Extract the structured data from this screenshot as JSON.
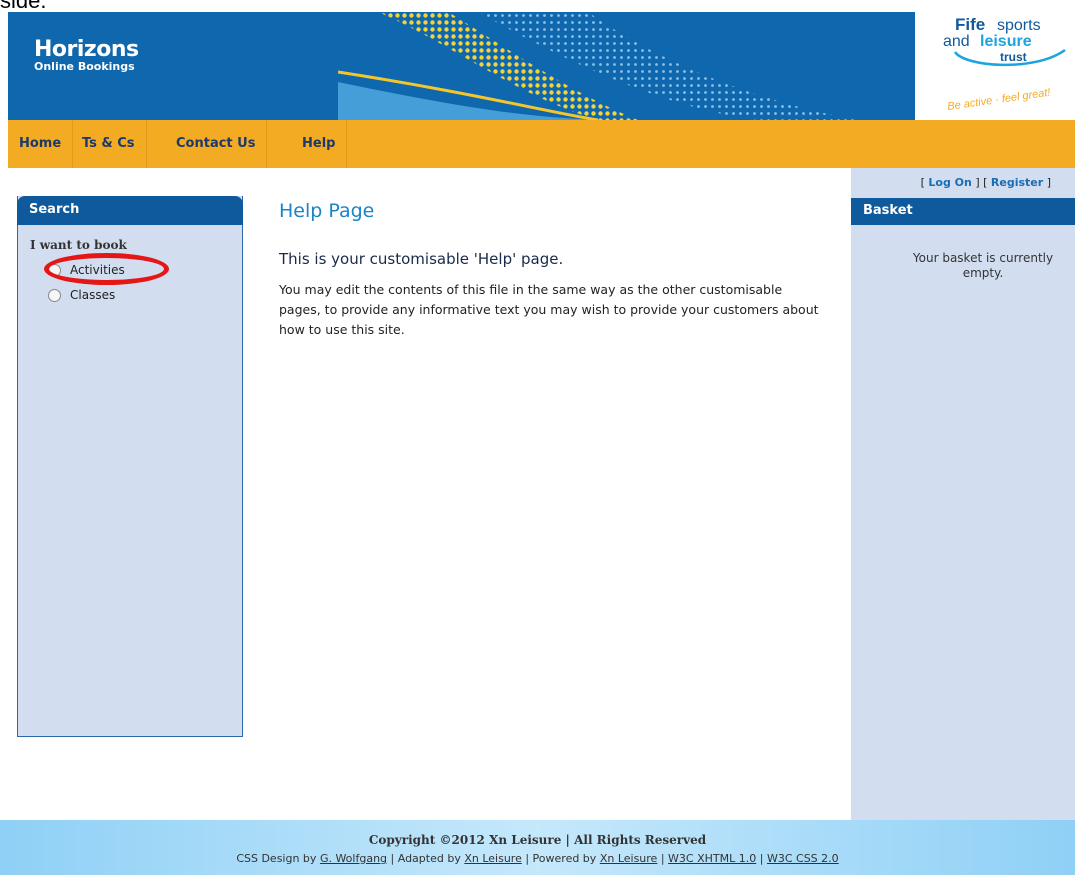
{
  "top_crop_text": "side.",
  "header": {
    "title": "Horizons",
    "subtitle": "Online Bookings",
    "logo": {
      "line1_bold": "Fife",
      "line1_rest": "sports",
      "line2_a": "and",
      "line2_b": "leisure",
      "line3": "trust",
      "tagline": "Be active · feel great!"
    }
  },
  "nav": {
    "items": [
      "Home",
      "Ts & Cs",
      "Contact Us",
      "Help"
    ]
  },
  "search": {
    "heading": "Search",
    "prompt": "I want to book",
    "options": [
      "Activities",
      "Classes"
    ]
  },
  "main": {
    "title": "Help Page",
    "subheading": "This is your customisable 'Help' page.",
    "body": "You may edit the contents of this file in the same way as the other customisable pages, to provide any informative text you may wish to provide your customers about how to use this site."
  },
  "account": {
    "open_bracket": "[",
    "login": "Log On",
    "middle": "] [",
    "register": "Register",
    "close_bracket": "]"
  },
  "basket": {
    "heading": "Basket",
    "empty_text": "Your basket is currently empty."
  },
  "footer": {
    "copyright": "Copyright ©2012 Xn Leisure | All Rights Reserved",
    "css_design_prefix": "CSS Design by",
    "css_designer": "G. Wolfgang",
    "adapted_prefix": "| Adapted by",
    "adapted_by": "Xn Leisure",
    "powered_prefix": "| Powered by",
    "powered_by": "Xn Leisure",
    "sep": "|",
    "xhtml": "W3C XHTML 1.0",
    "css": "W3C CSS 2.0"
  },
  "colors": {
    "header_blue": "#0f67ad",
    "nav_orange": "#f4ab24",
    "panel_light_blue": "#d2def0",
    "panel_head_blue": "#0f5a9c",
    "title_blue": "#1a84c7",
    "highlight_red": "#e51616"
  }
}
